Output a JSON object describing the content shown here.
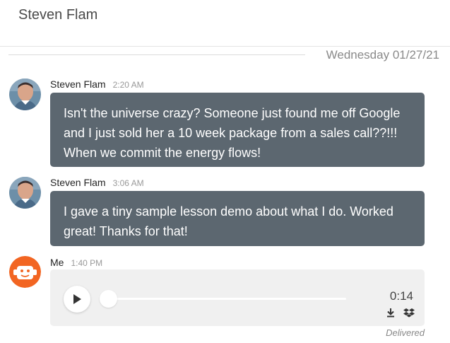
{
  "header": {
    "contact_name": "Steven Flam"
  },
  "date_divider": {
    "text": "Wednesday 01/27/21"
  },
  "messages": [
    {
      "sender": "Steven Flam",
      "time": "2:20 AM",
      "text": "Isn't the universe crazy? Someone just found me off Google and I just sold her a 10 week package from a sales call??!!! When we commit the energy flows!"
    },
    {
      "sender": "Steven Flam",
      "time": "3:06 AM",
      "text": "I gave a tiny sample lesson demo about what I do. Worked great! Thanks for that!"
    },
    {
      "sender": "Me",
      "time": "1:40 PM",
      "audio": {
        "duration": "0:14",
        "progress": 0
      },
      "status": "Delivered"
    }
  ],
  "icons": {
    "play": "play-icon",
    "download": "download-icon",
    "dropbox": "dropbox-icon"
  },
  "colors": {
    "bubble_bg": "#5c6770",
    "my_avatar": "#f26522",
    "audio_bg": "#f0f0f0"
  }
}
